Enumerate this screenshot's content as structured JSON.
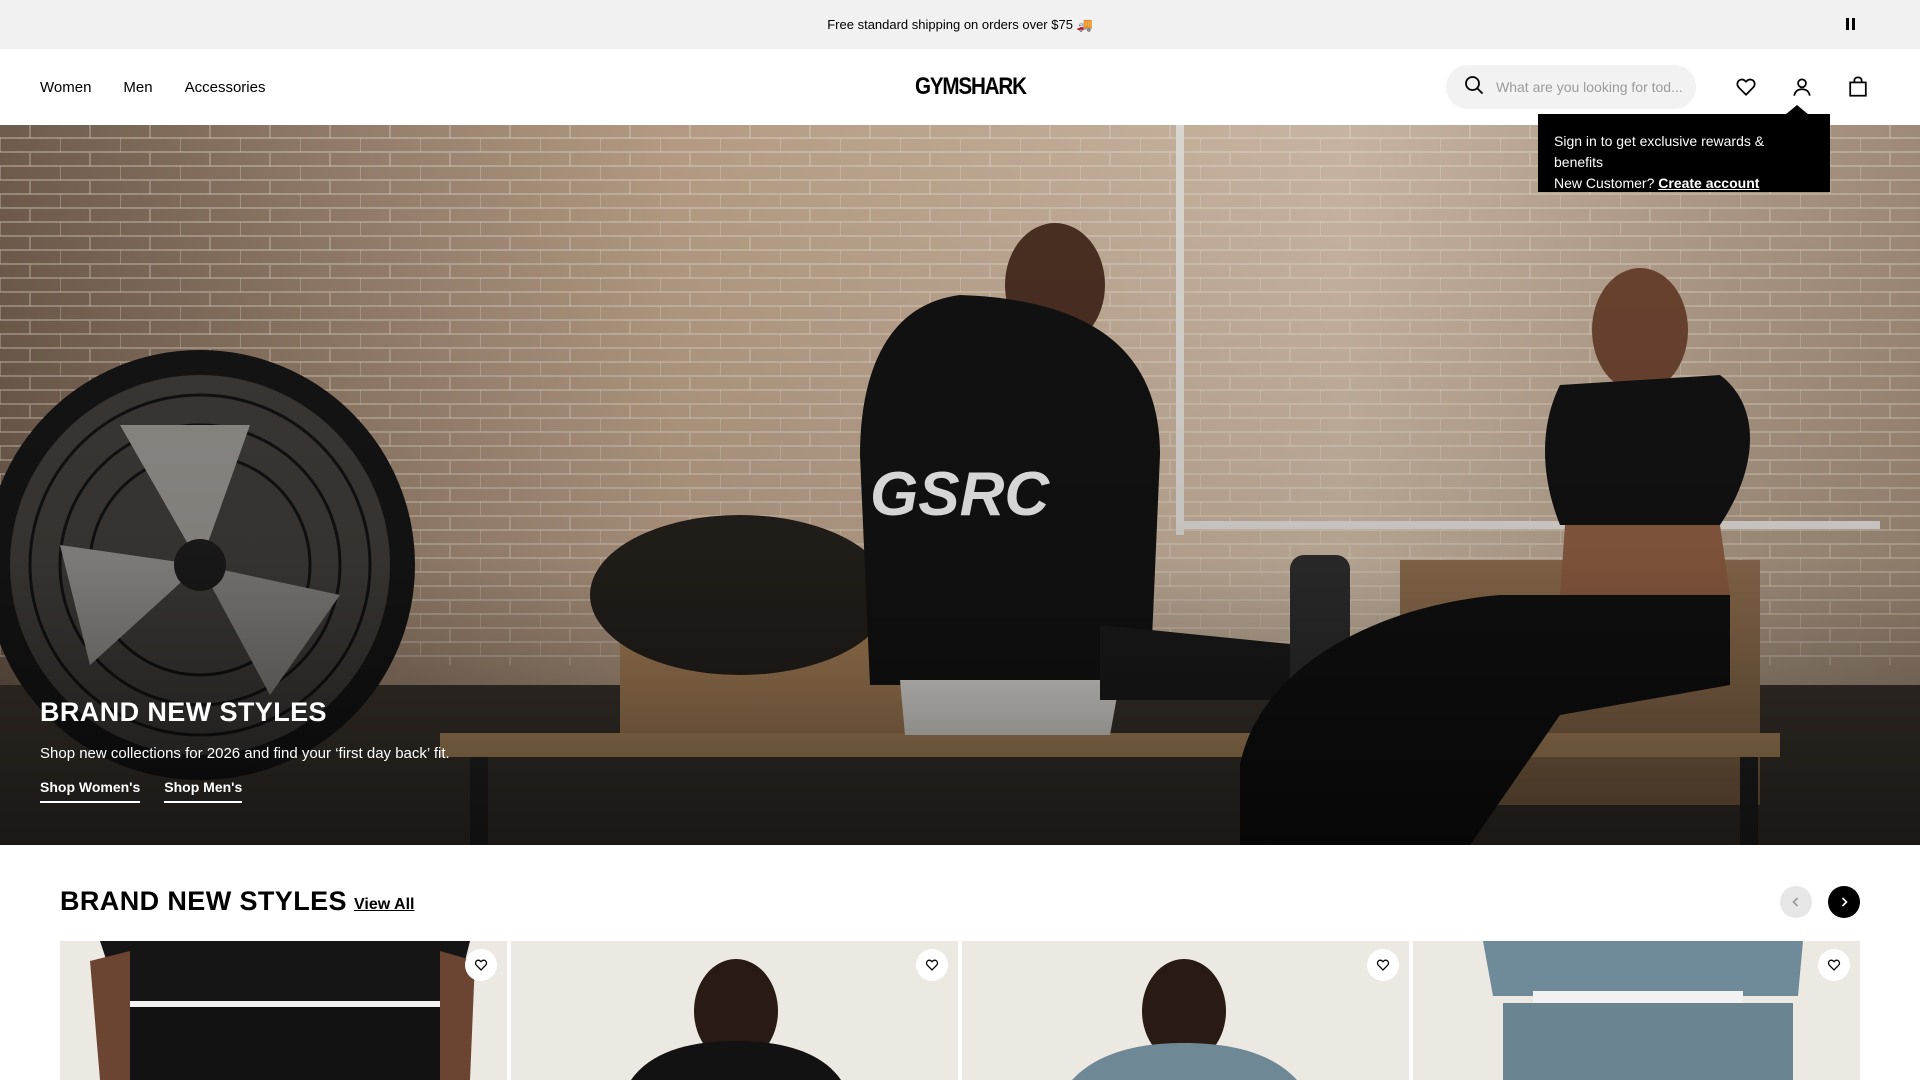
{
  "announcement": {
    "text": "Free standard shipping on orders over $75 🚚",
    "pause_icon": "pause-icon"
  },
  "header": {
    "nav": [
      "Women",
      "Men",
      "Accessories"
    ],
    "logo": "GYMSHARK",
    "search_placeholder": "What are you looking for tod...",
    "icons": [
      "search-icon",
      "heart-icon",
      "user-icon",
      "bag-icon"
    ]
  },
  "tooltip": {
    "line1": "Sign in to get exclusive rewards & benefits",
    "line2_prefix": "New Customer?",
    "create_account": "Create account"
  },
  "hero": {
    "title": "BRAND NEW STYLES",
    "subtitle": "Shop new collections for 2026 and find your ‘first day back’ fit.",
    "link_women": "Shop Women's",
    "link_men": "Shop Men's"
  },
  "section": {
    "title": "BRAND NEW STYLES",
    "view_all": "View All",
    "prev_icon": "chevron-left-icon",
    "next_icon": "chevron-right-icon"
  },
  "colors": {
    "black": "#000000",
    "announcement_bg": "#f1f1f1",
    "search_bg": "#f2f2f2"
  }
}
